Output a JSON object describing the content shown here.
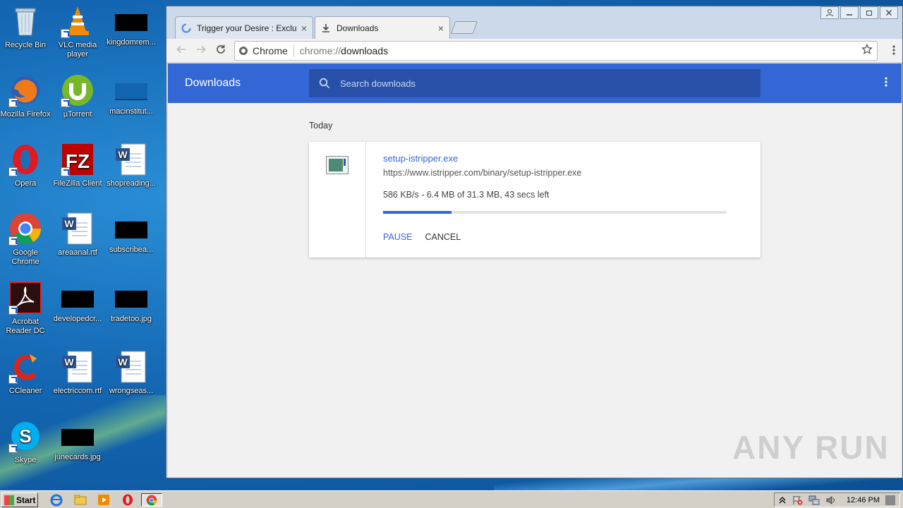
{
  "desktop": {
    "icons": [
      {
        "label": "Recycle Bin"
      },
      {
        "label": "VLC media player"
      },
      {
        "label": "kingdomrem..."
      },
      {
        "label": "Mozilla Firefox"
      },
      {
        "label": "µTorrent"
      },
      {
        "label": "macinstitut..."
      },
      {
        "label": "Opera"
      },
      {
        "label": "FileZilla Client"
      },
      {
        "label": "shopreading..."
      },
      {
        "label": "Google Chrome"
      },
      {
        "label": "areaanal.rtf"
      },
      {
        "label": "subscribea..."
      },
      {
        "label": "Acrobat Reader DC"
      },
      {
        "label": "developedcr..."
      },
      {
        "label": "tradetoo.jpg"
      },
      {
        "label": "CCleaner"
      },
      {
        "label": "electriccom.rtf"
      },
      {
        "label": "wrongseas..."
      },
      {
        "label": "Skype"
      },
      {
        "label": "junecards.jpg"
      }
    ]
  },
  "browser": {
    "tabs": [
      {
        "title": "Trigger your Desire : Exclus",
        "close": "×"
      },
      {
        "title": "Downloads",
        "close": "×"
      }
    ],
    "omnibox": {
      "chip": "Chrome",
      "scheme": "chrome://",
      "path": "downloads"
    }
  },
  "downloads": {
    "header_title": "Downloads",
    "search_placeholder": "Search downloads",
    "day_label": "Today",
    "item": {
      "filename": "setup-istripper.exe",
      "url": "https://www.istripper.com/binary/setup-istripper.exe",
      "status": "586 KB/s - 6.4 MB of 31.3 MB, 43 secs left",
      "progress_percent": 20,
      "pause_label": "PAUSE",
      "cancel_label": "CANCEL"
    }
  },
  "watermark": "ANY RUN",
  "taskbar": {
    "start_label": "Start",
    "clock": "12:46 PM"
  }
}
